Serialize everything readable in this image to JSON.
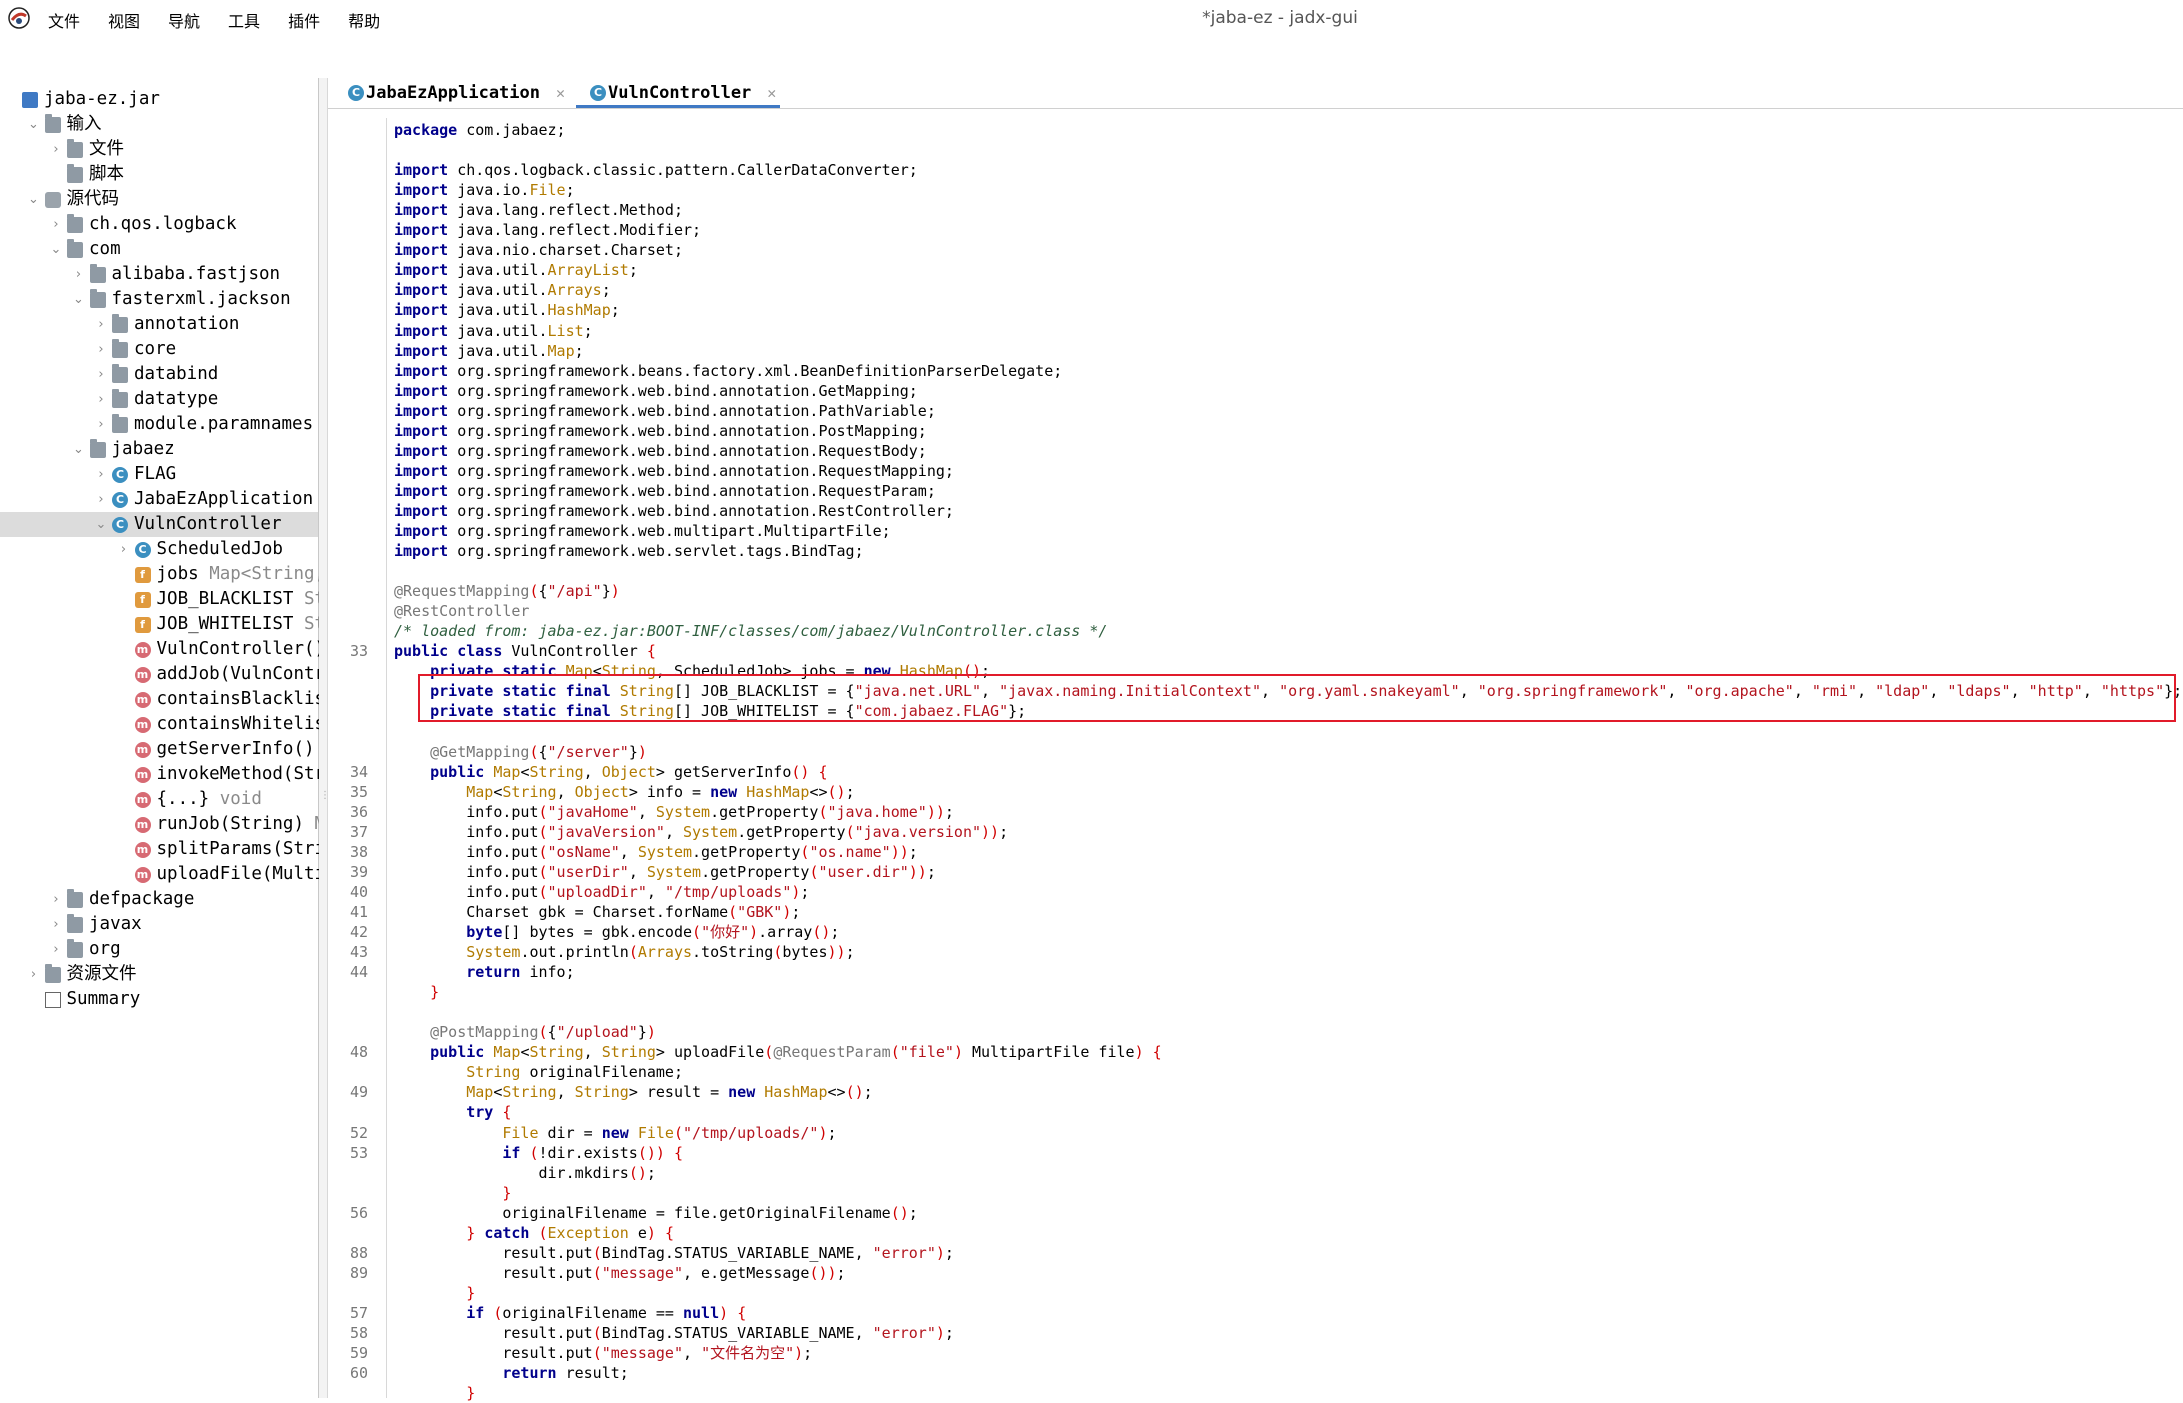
{
  "window": {
    "title": "*jaba-ez - jadx-gui"
  },
  "menu": [
    "文件",
    "视图",
    "导航",
    "工具",
    "插件",
    "帮助"
  ],
  "toolbar_icons": [
    "open-file-icon",
    "add-files-icon",
    "reload-icon",
    "save-icon",
    "export-icon",
    "flatten-icon",
    "package-icon",
    "search-icon",
    "find-usage-icon",
    "text-search-icon",
    "home-icon",
    "window-icon",
    "mcp-icon",
    "back-icon",
    "forward-icon",
    "quark-icon",
    "bookmark-icon",
    "debugger-icon",
    "log-icon",
    "settings-icon"
  ],
  "tree": [
    {
      "label": "jaba-ez.jar",
      "icon": "jar-icon",
      "indent": 0,
      "chev": ""
    },
    {
      "label": "输入",
      "icon": "input-icon",
      "indent": 1,
      "chev": "v"
    },
    {
      "label": "文件",
      "icon": "folder-icon",
      "indent": 2,
      "chev": ">"
    },
    {
      "label": "脚本",
      "icon": "folder-icon",
      "indent": 2,
      "chev": ""
    },
    {
      "label": "源代码",
      "icon": "source-icon",
      "indent": 1,
      "chev": "v"
    },
    {
      "label": "ch.qos.logback",
      "icon": "package-icon",
      "indent": 2,
      "chev": ">"
    },
    {
      "label": "com",
      "icon": "package-icon",
      "indent": 2,
      "chev": "v"
    },
    {
      "label": "alibaba.fastjson",
      "icon": "package-icon",
      "indent": 3,
      "chev": ">"
    },
    {
      "label": "fasterxml.jackson",
      "icon": "package-icon",
      "indent": 3,
      "chev": "v"
    },
    {
      "label": "annotation",
      "icon": "package-icon",
      "indent": 4,
      "chev": ">"
    },
    {
      "label": "core",
      "icon": "package-icon",
      "indent": 4,
      "chev": ">"
    },
    {
      "label": "databind",
      "icon": "package-icon",
      "indent": 4,
      "chev": ">"
    },
    {
      "label": "datatype",
      "icon": "package-icon",
      "indent": 4,
      "chev": ">"
    },
    {
      "label": "module.paramnames",
      "icon": "package-icon",
      "indent": 4,
      "chev": ">"
    },
    {
      "label": "jabaez",
      "icon": "package-icon",
      "indent": 3,
      "chev": "v"
    },
    {
      "label": "FLAG",
      "icon": "class-icon",
      "indent": 4,
      "chev": ">"
    },
    {
      "label": "JabaEzApplication",
      "icon": "class-icon",
      "indent": 4,
      "chev": ">"
    },
    {
      "label": "VulnController",
      "icon": "class-icon",
      "indent": 4,
      "chev": "v",
      "selected": true
    },
    {
      "label": "ScheduledJob",
      "icon": "class-icon",
      "indent": 5,
      "chev": ">"
    },
    {
      "label": "jobs",
      "suffix": "Map<String,",
      "icon": "field-icon",
      "indent": 5,
      "chev": ""
    },
    {
      "label": "JOB_BLACKLIST",
      "suffix": "St",
      "icon": "field-icon",
      "indent": 5,
      "chev": ""
    },
    {
      "label": "JOB_WHITELIST",
      "suffix": "St",
      "icon": "field-icon",
      "indent": 5,
      "chev": ""
    },
    {
      "label": "VulnController()",
      "icon": "method-icon",
      "indent": 5,
      "chev": ""
    },
    {
      "label": "addJob(VulnContr",
      "icon": "method-icon",
      "indent": 5,
      "chev": ""
    },
    {
      "label": "containsBlacklis",
      "icon": "method-icon",
      "indent": 5,
      "chev": ""
    },
    {
      "label": "containsWhitelis",
      "icon": "method-icon",
      "indent": 5,
      "chev": ""
    },
    {
      "label": "getServerInfo()",
      "icon": "method-icon",
      "indent": 5,
      "chev": ""
    },
    {
      "label": "invokeMethod(Str",
      "icon": "method-icon",
      "indent": 5,
      "chev": ""
    },
    {
      "label": "{...}",
      "suffix": "void",
      "icon": "method-icon",
      "indent": 5,
      "chev": ""
    },
    {
      "label": "runJob(String)",
      "suffix": "M",
      "icon": "method-icon",
      "indent": 5,
      "chev": ""
    },
    {
      "label": "splitParams(Stri",
      "icon": "method-icon",
      "indent": 5,
      "chev": ""
    },
    {
      "label": "uploadFile(Multi",
      "icon": "method-icon",
      "indent": 5,
      "chev": ""
    },
    {
      "label": "defpackage",
      "icon": "package-icon",
      "indent": 2,
      "chev": ">"
    },
    {
      "label": "javax",
      "icon": "package-icon",
      "indent": 2,
      "chev": ">"
    },
    {
      "label": "org",
      "icon": "package-icon",
      "indent": 2,
      "chev": ">"
    },
    {
      "label": "资源文件",
      "icon": "resources-icon",
      "indent": 1,
      "chev": ">"
    },
    {
      "label": "Summary",
      "icon": "summary-icon",
      "indent": 1,
      "chev": ""
    }
  ],
  "tabs": [
    {
      "label": "JabaEzApplication",
      "active": false
    },
    {
      "label": "VulnController",
      "active": true
    }
  ],
  "code_lines": [
    {
      "ln": "",
      "html": "<span class='k'>package</span> com.jabaez;"
    },
    {
      "ln": "",
      "html": ""
    },
    {
      "ln": "",
      "html": "<span class='k'>import</span> ch.qos.logback.classic.pattern.CallerDataConverter;"
    },
    {
      "ln": "",
      "html": "<span class='k'>import</span> java.io.<span class='t'>File</span>;"
    },
    {
      "ln": "",
      "html": "<span class='k'>import</span> java.lang.reflect.Method;"
    },
    {
      "ln": "",
      "html": "<span class='k'>import</span> java.lang.reflect.Modifier;"
    },
    {
      "ln": "",
      "html": "<span class='k'>import</span> java.nio.charset.Charset;"
    },
    {
      "ln": "",
      "html": "<span class='k'>import</span> java.util.<span class='t'>ArrayList</span>;"
    },
    {
      "ln": "",
      "html": "<span class='k'>import</span> java.util.<span class='t'>Arrays</span>;"
    },
    {
      "ln": "",
      "html": "<span class='k'>import</span> java.util.<span class='t'>HashMap</span>;"
    },
    {
      "ln": "",
      "html": "<span class='k'>import</span> java.util.<span class='t'>List</span>;"
    },
    {
      "ln": "",
      "html": "<span class='k'>import</span> java.util.<span class='t'>Map</span>;"
    },
    {
      "ln": "",
      "html": "<span class='k'>import</span> org.springframework.beans.factory.xml.BeanDefinitionParserDelegate;"
    },
    {
      "ln": "",
      "html": "<span class='k'>import</span> org.springframework.web.bind.annotation.GetMapping;"
    },
    {
      "ln": "",
      "html": "<span class='k'>import</span> org.springframework.web.bind.annotation.PathVariable;"
    },
    {
      "ln": "",
      "html": "<span class='k'>import</span> org.springframework.web.bind.annotation.PostMapping;"
    },
    {
      "ln": "",
      "html": "<span class='k'>import</span> org.springframework.web.bind.annotation.RequestBody;"
    },
    {
      "ln": "",
      "html": "<span class='k'>import</span> org.springframework.web.bind.annotation.RequestMapping;"
    },
    {
      "ln": "",
      "html": "<span class='k'>import</span> org.springframework.web.bind.annotation.RequestParam;"
    },
    {
      "ln": "",
      "html": "<span class='k'>import</span> org.springframework.web.bind.annotation.RestController;"
    },
    {
      "ln": "",
      "html": "<span class='k'>import</span> org.springframework.web.multipart.MultipartFile;"
    },
    {
      "ln": "",
      "html": "<span class='k'>import</span> org.springframework.web.servlet.tags.BindTag;"
    },
    {
      "ln": "",
      "html": ""
    },
    {
      "ln": "",
      "html": "<span class='a'>@RequestMapping</span><span class='p'>(</span>{<span class='s'>\"/api\"</span>}<span class='p'>)</span>"
    },
    {
      "ln": "",
      "html": "<span class='a'>@RestController</span>"
    },
    {
      "ln": "",
      "html": "<span class='c'>/* loaded from: jaba-ez.jar:BOOT-INF/classes/com/jabaez/VulnController.class */</span>"
    },
    {
      "ln": "33",
      "html": "<span class='k'>public class</span> VulnController <span class='p'>{</span>"
    },
    {
      "ln": "",
      "html": "    <span class='k'>private static</span> <span class='t'>Map</span>&lt;<span class='t'>String</span>, ScheduledJob&gt; jobs = <span class='k'>new</span> <span class='t'>HashMap</span><span class='p'>()</span>;"
    },
    {
      "ln": "",
      "html": "    <span class='k'>private static final</span> <span class='t'>String</span>[] JOB_BLACKLIST = {<span class='s'>\"java.net.URL\"</span>, <span class='s'>\"javax.naming.InitialContext\"</span>, <span class='s'>\"org.yaml.snakeyaml\"</span>, <span class='s'>\"org.springframework\"</span>, <span class='s'>\"org.apache\"</span>, <span class='s'>\"rmi\"</span>, <span class='s'>\"ldap\"</span>, <span class='s'>\"ldaps\"</span>, <span class='s'>\"http\"</span>, <span class='s'>\"https\"</span>};"
    },
    {
      "ln": "",
      "html": "    <span class='k'>private static final</span> <span class='t'>String</span>[] JOB_WHITELIST = {<span class='s'>\"com.jabaez.FLAG\"</span>};"
    },
    {
      "ln": "",
      "html": ""
    },
    {
      "ln": "",
      "html": "    <span class='a'>@GetMapping</span><span class='p'>(</span>{<span class='s'>\"/server\"</span>}<span class='p'>)</span>"
    },
    {
      "ln": "34",
      "html": "    <span class='k'>public</span> <span class='t'>Map</span>&lt;<span class='t'>String</span>, <span class='t'>Object</span>&gt; getServerInfo<span class='p'>()</span> <span class='p'>{</span>"
    },
    {
      "ln": "35",
      "html": "        <span class='t'>Map</span>&lt;<span class='t'>String</span>, <span class='t'>Object</span>&gt; info = <span class='k'>new</span> <span class='t'>HashMap</span>&lt;&gt;<span class='p'>()</span>;"
    },
    {
      "ln": "36",
      "html": "        info.put<span class='p'>(</span><span class='s'>\"javaHome\"</span>, <span class='t'>System</span>.getProperty<span class='p'>(</span><span class='s'>\"java.home\"</span><span class='p'>))</span>;"
    },
    {
      "ln": "37",
      "html": "        info.put<span class='p'>(</span><span class='s'>\"javaVersion\"</span>, <span class='t'>System</span>.getProperty<span class='p'>(</span><span class='s'>\"java.version\"</span><span class='p'>))</span>;"
    },
    {
      "ln": "38",
      "html": "        info.put<span class='p'>(</span><span class='s'>\"osName\"</span>, <span class='t'>System</span>.getProperty<span class='p'>(</span><span class='s'>\"os.name\"</span><span class='p'>))</span>;"
    },
    {
      "ln": "39",
      "html": "        info.put<span class='p'>(</span><span class='s'>\"userDir\"</span>, <span class='t'>System</span>.getProperty<span class='p'>(</span><span class='s'>\"user.dir\"</span><span class='p'>))</span>;"
    },
    {
      "ln": "40",
      "html": "        info.put<span class='p'>(</span><span class='s'>\"uploadDir\"</span>, <span class='s'>\"/tmp/uploads\"</span><span class='p'>)</span>;"
    },
    {
      "ln": "41",
      "html": "        Charset gbk = Charset.forName<span class='p'>(</span><span class='s'>\"GBK\"</span><span class='p'>)</span>;"
    },
    {
      "ln": "42",
      "html": "        <span class='k'>byte</span>[] bytes = gbk.encode<span class='p'>(</span><span class='s'>\"你好\"</span><span class='p'>)</span>.array<span class='p'>()</span>;"
    },
    {
      "ln": "43",
      "html": "        <span class='t'>System</span>.out.println<span class='p'>(</span><span class='t'>Arrays</span>.toString<span class='p'>(</span>bytes<span class='p'>))</span>;"
    },
    {
      "ln": "44",
      "html": "        <span class='k'>return</span> info;"
    },
    {
      "ln": "",
      "html": "    <span class='p'>}</span>"
    },
    {
      "ln": "",
      "html": ""
    },
    {
      "ln": "",
      "html": "    <span class='a'>@PostMapping</span><span class='p'>(</span>{<span class='s'>\"/upload\"</span>}<span class='p'>)</span>"
    },
    {
      "ln": "48",
      "html": "    <span class='k'>public</span> <span class='t'>Map</span>&lt;<span class='t'>String</span>, <span class='t'>String</span>&gt; uploadFile<span class='p'>(</span><span class='a'>@RequestParam</span><span class='p'>(</span><span class='s'>\"file\"</span><span class='p'>)</span> MultipartFile file<span class='p'>)</span> <span class='p'>{</span>"
    },
    {
      "ln": "",
      "html": "        <span class='t'>String</span> originalFilename;"
    },
    {
      "ln": "49",
      "html": "        <span class='t'>Map</span>&lt;<span class='t'>String</span>, <span class='t'>String</span>&gt; result = <span class='k'>new</span> <span class='t'>HashMap</span>&lt;&gt;<span class='p'>()</span>;"
    },
    {
      "ln": "",
      "html": "        <span class='k'>try</span> <span class='p'>{</span>"
    },
    {
      "ln": "52",
      "html": "            <span class='t'>File</span> dir = <span class='k'>new</span> <span class='t'>File</span><span class='p'>(</span><span class='s'>\"/tmp/uploads/\"</span><span class='p'>)</span>;"
    },
    {
      "ln": "53",
      "html": "            <span class='k'>if</span> <span class='p'>(</span>!dir.exists<span class='p'>())</span> <span class='p'>{</span>"
    },
    {
      "ln": "",
      "html": "                dir.mkdirs<span class='p'>()</span>;"
    },
    {
      "ln": "",
      "html": "            <span class='p'>}</span>"
    },
    {
      "ln": "56",
      "html": "            originalFilename = file.getOriginalFilename<span class='p'>()</span>;"
    },
    {
      "ln": "",
      "html": "        <span class='p'>}</span> <span class='k'>catch</span> <span class='p'>(</span><span class='t'>Exception</span> e<span class='p'>)</span> <span class='p'>{</span>"
    },
    {
      "ln": "88",
      "html": "            result.put<span class='p'>(</span>BindTag.STATUS_VARIABLE_NAME, <span class='s'>\"error\"</span><span class='p'>)</span>;"
    },
    {
      "ln": "89",
      "html": "            result.put<span class='p'>(</span><span class='s'>\"message\"</span>, e.getMessage<span class='p'>())</span>;"
    },
    {
      "ln": "",
      "html": "        <span class='p'>}</span>"
    },
    {
      "ln": "57",
      "html": "        <span class='k'>if</span> <span class='p'>(</span>originalFilename == <span class='k'>null</span><span class='p'>)</span> <span class='p'>{</span>"
    },
    {
      "ln": "58",
      "html": "            result.put<span class='p'>(</span>BindTag.STATUS_VARIABLE_NAME, <span class='s'>\"error\"</span><span class='p'>)</span>;"
    },
    {
      "ln": "59",
      "html": "            result.put<span class='p'>(</span><span class='s'>\"message\"</span>, <span class='s'>\"文件名为空\"</span><span class='p'>)</span>;"
    },
    {
      "ln": "60",
      "html": "            <span class='k'>return</span> result;"
    },
    {
      "ln": "",
      "html": "        <span class='p'>}</span>"
    }
  ]
}
